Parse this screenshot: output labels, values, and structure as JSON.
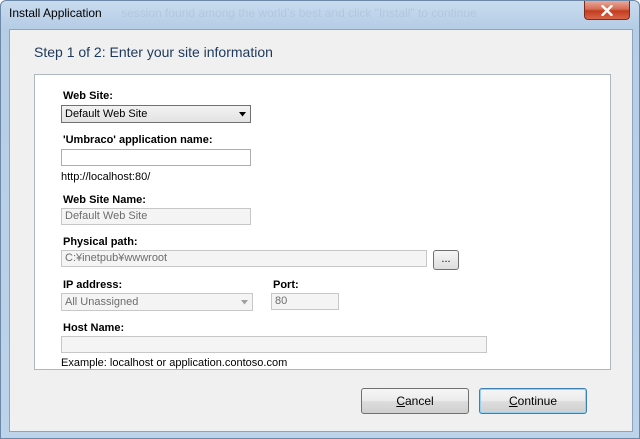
{
  "window": {
    "title": "Install Application",
    "title_ghost_text": "session found among the world's best and click \"Install\" to continue"
  },
  "step": {
    "title": "Step 1 of 2: Enter your site information"
  },
  "form": {
    "web_site_label": "Web Site:",
    "web_site_value": "Default Web Site",
    "app_name_label": "'Umbraco' application name:",
    "app_name_value": "",
    "url_preview": "http://localhost:80/",
    "site_name_label": "Web Site Name:",
    "site_name_value": "Default Web Site",
    "physical_path_label": "Physical path:",
    "physical_path_value": "C:¥inetpub¥wwwroot",
    "browse_label": "...",
    "ip_label": "IP address:",
    "ip_value": "All Unassigned",
    "port_label": "Port:",
    "port_value": "80",
    "host_label": "Host Name:",
    "host_value": "",
    "host_example": "Example: localhost or application.contoso.com"
  },
  "buttons": {
    "cancel_mnemonic": "C",
    "cancel_rest": "ancel",
    "continue_mnemonic": "C",
    "continue_rest": "ontinue"
  },
  "icons": [
    "close-icon",
    "dropdown-arrow-icon"
  ]
}
